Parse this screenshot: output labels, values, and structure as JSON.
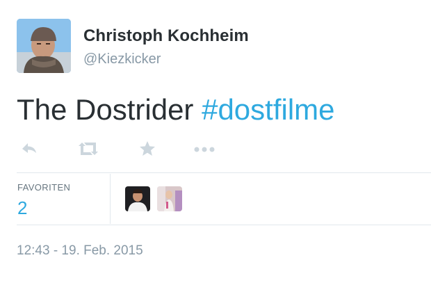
{
  "author": {
    "name": "Christoph Kochheim",
    "handle": "@Kiezkicker"
  },
  "tweet": {
    "text": "The Dostrider ",
    "hashtag": "#dostfilme"
  },
  "actions": [
    {
      "icon": "reply-icon"
    },
    {
      "icon": "retweet-icon"
    },
    {
      "icon": "favorite-star-icon"
    },
    {
      "icon": "more-dots-icon"
    }
  ],
  "stats": {
    "favorites_label": "FAVORITEN",
    "favorites_count": "2"
  },
  "timestamp": "12:43 - 19. Feb. 2015",
  "colors": {
    "accent": "#2ea9df",
    "text": "#292f33",
    "muted": "#8899a6",
    "icon": "#ccd6dd",
    "divider": "#e1e8ed"
  }
}
